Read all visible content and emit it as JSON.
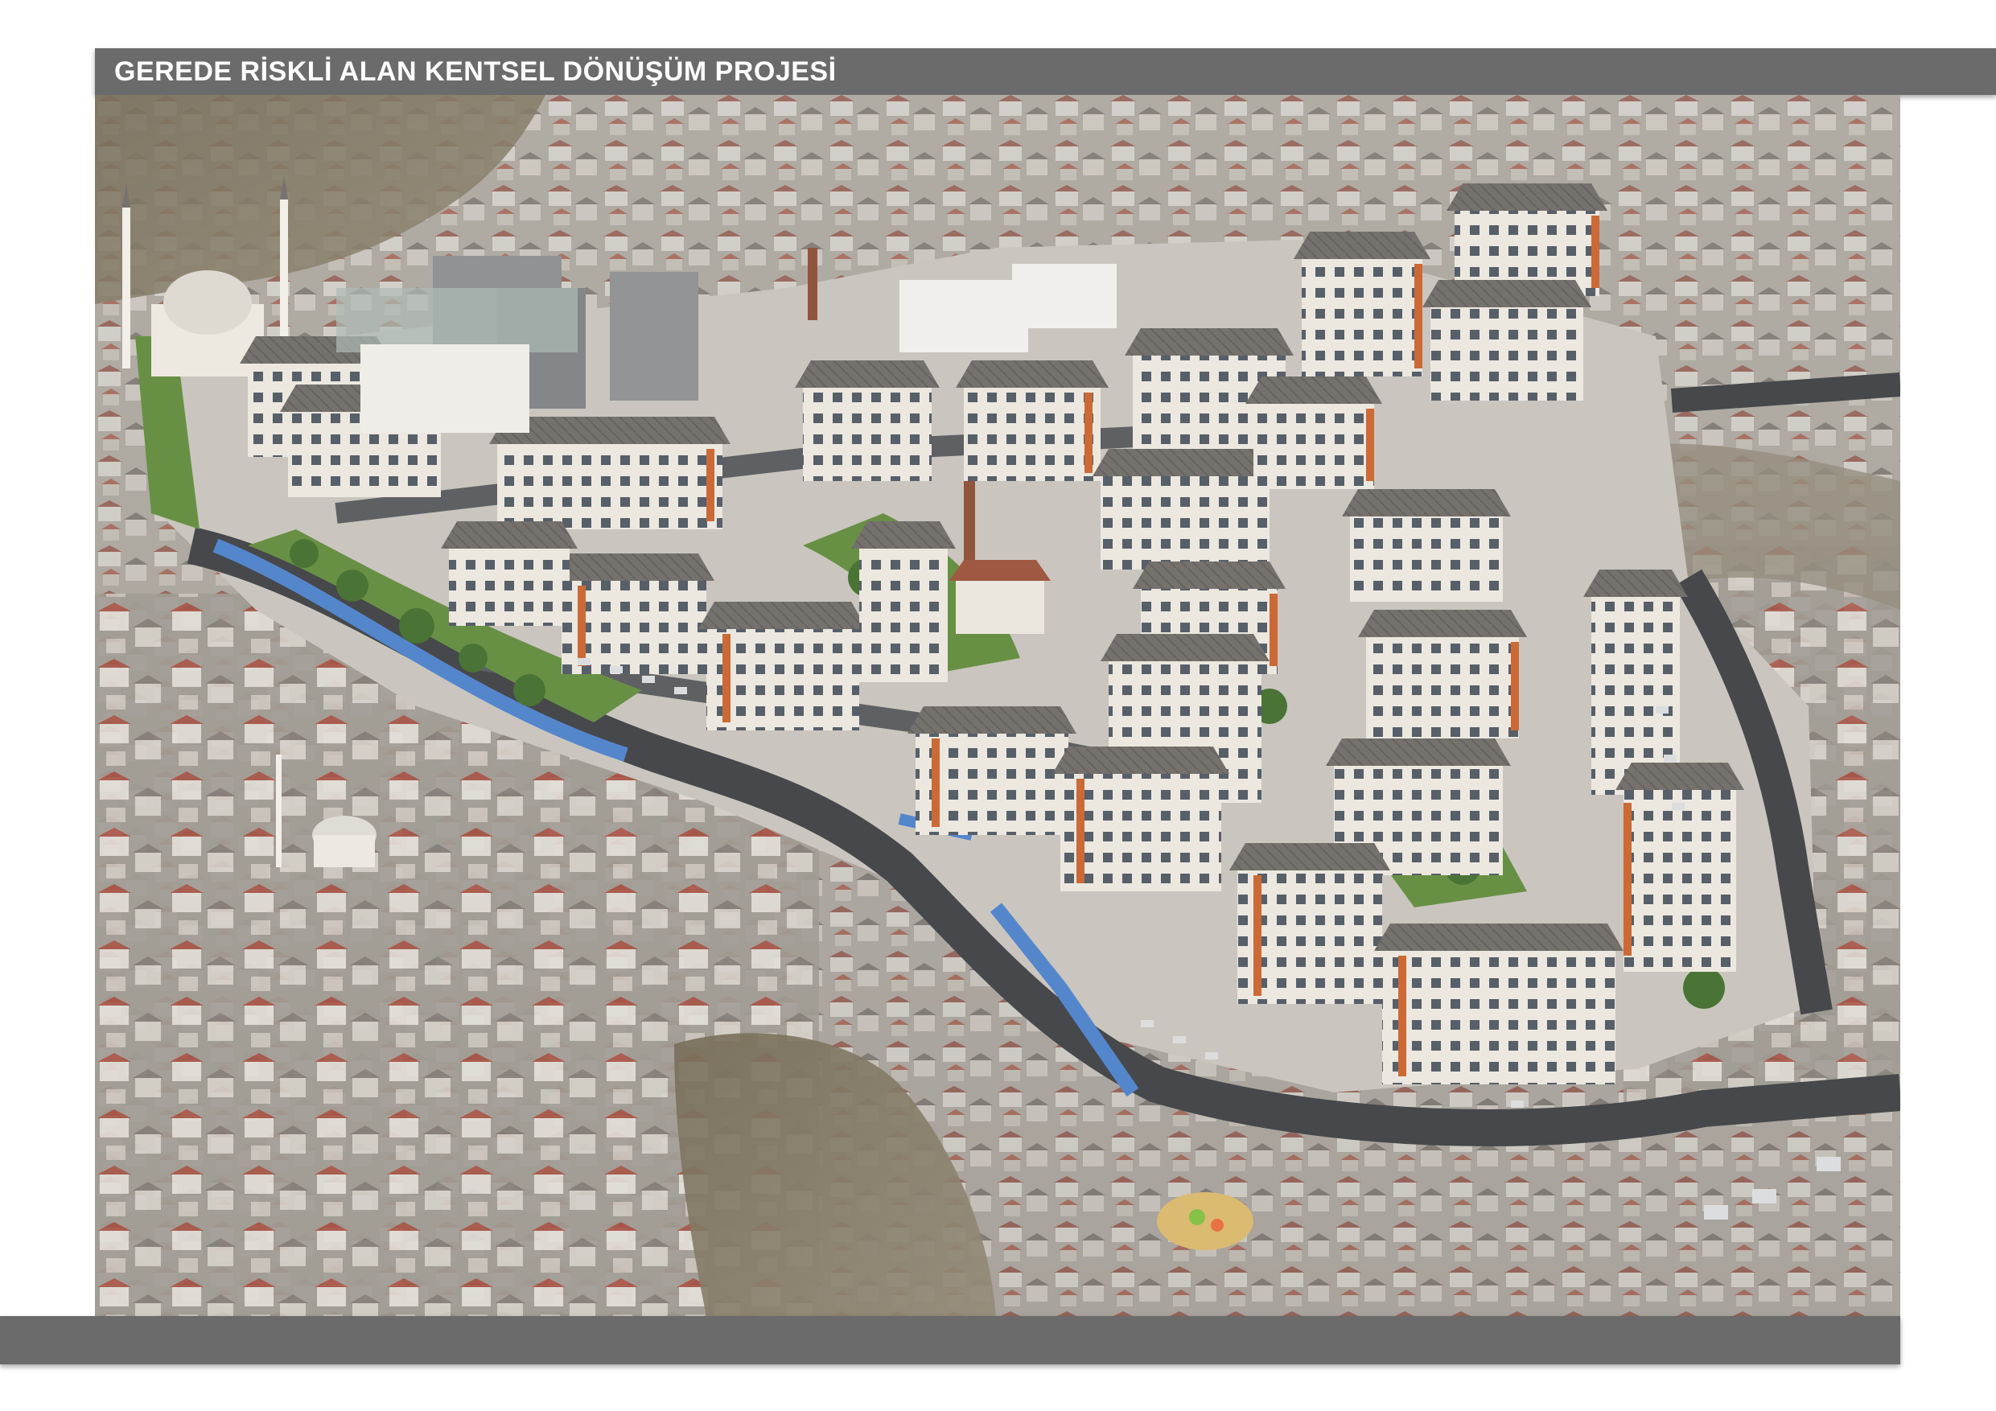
{
  "header": {
    "title": "GEREDE RİSKLİ ALAN KENTSEL DÖNÜŞÜM PROJESİ"
  },
  "image": {
    "kind": "aerial-rendering-photo",
    "colors": {
      "bar": "#6b6b6b",
      "city": "#a39e97",
      "roofs_red": "#9e4a3c",
      "hill": "#7a6f5c",
      "road": "#3b3d40",
      "canal": "#4a7fc9",
      "grass": "#5f8a3a",
      "building_wall": "#e8e4dc",
      "building_roof": "#6e6a66",
      "accent_orange": "#c8612a"
    }
  }
}
